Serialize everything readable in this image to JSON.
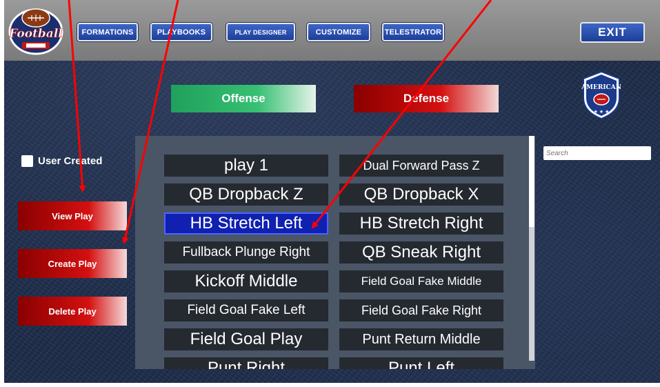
{
  "nav": {
    "formations": "FORMATIONS",
    "playbooks": "PLAYBOOKS",
    "play_designer": "PLAY DESIGNER",
    "customize": "CUSTOMIZE",
    "telestrator": "TELESTRATOR",
    "exit": "EXIT"
  },
  "logo": {
    "text": "Football"
  },
  "badge": {
    "text": "AMERICAN"
  },
  "toggles": {
    "offense": "Offense",
    "defense": "Defense"
  },
  "filters": {
    "user_created": "User Created"
  },
  "actions": {
    "view": "View Play",
    "create": "Create Play",
    "delete": "Delete Play"
  },
  "search": {
    "placeholder": "Search"
  },
  "plays": [
    "play 1",
    "Dual Forward Pass Z",
    "QB Dropback Z",
    "QB Dropback X",
    "HB Stretch Left",
    "HB Stretch Right",
    "Fullback Plunge Right",
    "QB Sneak Right",
    "Kickoff Middle",
    "Field Goal Fake Middle",
    "Field Goal Fake Left",
    "Field Goal Fake Right",
    "Field Goal Play",
    "Punt Return Middle",
    "Punt Right",
    "Punt Left"
  ],
  "selected_play": "HB Stretch Left",
  "colors": {
    "nav_blue": "#2a52b8",
    "offense_green": "#2fb268",
    "defense_red": "#c80a0a",
    "annotation_red": "#ff0000"
  }
}
